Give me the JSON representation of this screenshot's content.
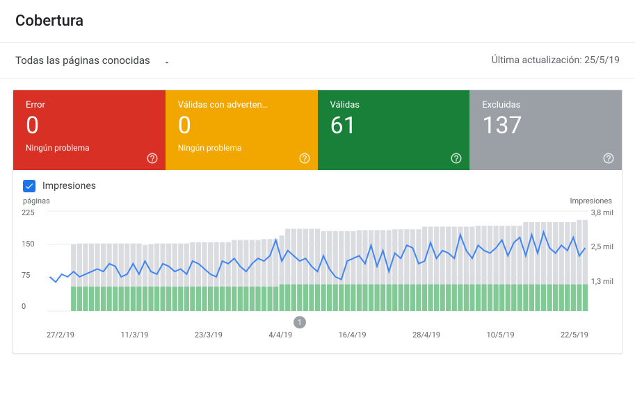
{
  "header": {
    "title": "Cobertura"
  },
  "filter": {
    "dropdown_label": "Todas las páginas conocidas",
    "last_update_prefix": "Última actualización: ",
    "last_update_date": "25/5/19"
  },
  "tiles": {
    "error": {
      "label": "Error",
      "value": "0",
      "sub": "Ningún problema"
    },
    "warn": {
      "label": "Válidas con adverten…",
      "value": "0",
      "sub": "Ningún problema"
    },
    "valid": {
      "label": "Válidas",
      "value": "61",
      "sub": ""
    },
    "excluded": {
      "label": "Excluidas",
      "value": "137",
      "sub": ""
    }
  },
  "impressions_label": "Impresiones",
  "chart_data": {
    "type": "bar+line",
    "left_axis_title": "páginas",
    "right_axis_title": "Impresiones",
    "left_ticks": [
      "225",
      "150",
      "75",
      "0"
    ],
    "right_ticks": [
      "3,8 mil",
      "2,5 mil",
      "1,3 mil",
      ""
    ],
    "x_ticks": [
      "27/2/19",
      "11/3/19",
      "23/3/19",
      "4/4/19",
      "16/4/19",
      "28/4/19",
      "10/5/19",
      "22/5/19"
    ],
    "ylim_pages": [
      0,
      225
    ],
    "ylim_impressions": [
      0,
      3800
    ],
    "marker_label": "1",
    "series": [
      {
        "name": "Excluidas_bar",
        "kind": "bar",
        "color": "#dadce0",
        "values": [
          0,
          0,
          0,
          0,
          150,
          152,
          152,
          152,
          152,
          152,
          152,
          152,
          152,
          152,
          152,
          152,
          148,
          150,
          152,
          152,
          152,
          152,
          152,
          152,
          155,
          155,
          155,
          155,
          155,
          155,
          155,
          160,
          160,
          160,
          160,
          160,
          162,
          162,
          162,
          170,
          185,
          185,
          185,
          185,
          185,
          185,
          180,
          180,
          180,
          180,
          180,
          180,
          182,
          182,
          182,
          182,
          182,
          182,
          184,
          184,
          184,
          184,
          184,
          190,
          190,
          190,
          190,
          190,
          190,
          190,
          190,
          190,
          192,
          192,
          192,
          192,
          192,
          192,
          192,
          192,
          200,
          200,
          200,
          200,
          200,
          200,
          200,
          200,
          200,
          205,
          205
        ]
      },
      {
        "name": "Válidas_bar",
        "kind": "bar",
        "color": "#81c995",
        "values": [
          0,
          0,
          0,
          0,
          55,
          55,
          55,
          55,
          55,
          55,
          55,
          55,
          55,
          55,
          55,
          55,
          55,
          55,
          55,
          55,
          55,
          55,
          55,
          55,
          55,
          55,
          55,
          55,
          55,
          55,
          55,
          55,
          55,
          55,
          55,
          55,
          55,
          55,
          55,
          60,
          60,
          60,
          60,
          60,
          60,
          60,
          60,
          60,
          60,
          60,
          60,
          60,
          60,
          60,
          60,
          60,
          60,
          60,
          60,
          60,
          60,
          60,
          60,
          60,
          60,
          60,
          60,
          60,
          60,
          60,
          60,
          60,
          60,
          60,
          60,
          60,
          60,
          60,
          60,
          60,
          60,
          60,
          60,
          60,
          60,
          60,
          60,
          60,
          60,
          60,
          60
        ]
      },
      {
        "name": "Impresiones_line",
        "kind": "line",
        "color": "#4285f4",
        "values": [
          1300,
          1100,
          1400,
          1300,
          1500,
          1300,
          1400,
          1500,
          1600,
          1500,
          1800,
          1700,
          1300,
          1400,
          1800,
          1400,
          1900,
          1500,
          1400,
          1800,
          1700,
          1500,
          1600,
          1400,
          1900,
          1800,
          1600,
          1400,
          1300,
          1900,
          1800,
          2000,
          1700,
          1500,
          1800,
          2000,
          1900,
          2100,
          2700,
          1900,
          2300,
          2100,
          1900,
          2000,
          1700,
          1500,
          2100,
          1600,
          1300,
          1200,
          1900,
          2000,
          2100,
          1800,
          2500,
          1700,
          2300,
          1500,
          2200,
          2000,
          2500,
          2400,
          1800,
          1900,
          2600,
          2000,
          2300,
          2200,
          2000,
          2900,
          2300,
          2000,
          2500,
          2300,
          2200,
          2400,
          2700,
          2100,
          2600,
          2800,
          2100,
          2900,
          2200,
          3000,
          2400,
          2200,
          2500,
          2300,
          2800,
          2100,
          2400
        ]
      }
    ]
  }
}
